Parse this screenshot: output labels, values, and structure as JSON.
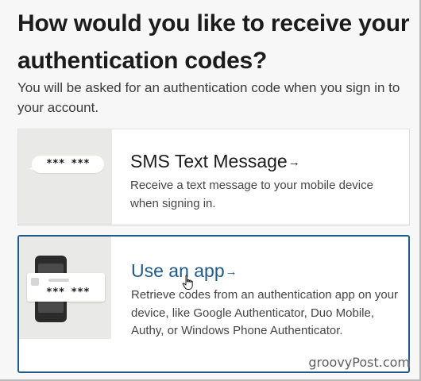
{
  "heading": "How would you like to receive your authentication codes?",
  "subtitle": "You will be asked for an authentication code when you sign in to your account.",
  "options": [
    {
      "id": "sms",
      "title": "SMS Text Message",
      "arrow": "→",
      "description": "Receive a text message to your mobile device when signing in.",
      "illustration_code": "*** ***",
      "selected": false
    },
    {
      "id": "app",
      "title": "Use an app",
      "arrow": "→",
      "description": "Retrieve codes from an authentication app on your device, like Google Authenticator, Duo Mobile, Authy, or Windows Phone Authenticator.",
      "illustration_code": "*** ***",
      "selected": true
    }
  ],
  "watermark": "groovyPost.com",
  "colors": {
    "selected_border": "#1f5a8c",
    "selected_title": "#1f5a8c",
    "text": "#1d1c1d",
    "background": "#f7f7f7"
  },
  "icons": {
    "sms_illustration": "sms-bubble-icon",
    "app_illustration": "phone-app-icon",
    "cursor": "hand-pointer-icon"
  }
}
